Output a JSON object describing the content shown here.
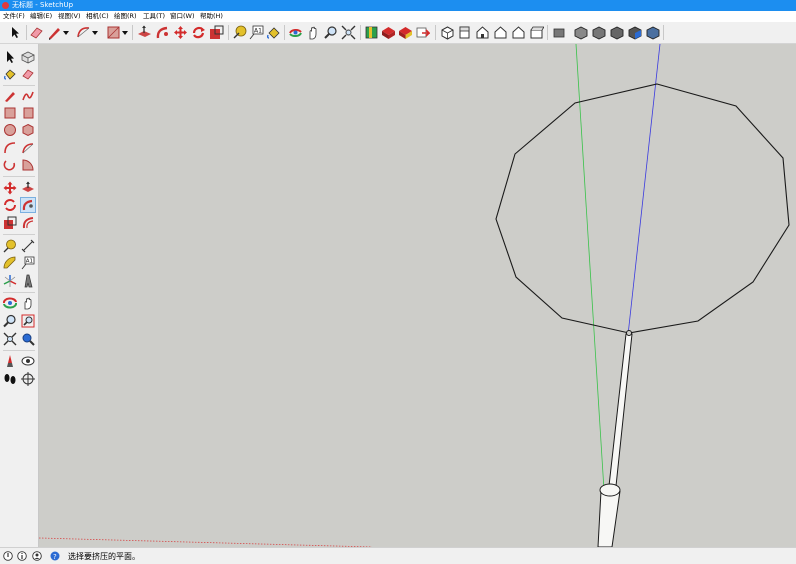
{
  "window": {
    "title": "无标题 - SketchUp"
  },
  "menu": [
    "文件(F)",
    "编辑(E)",
    "视图(V)",
    "相机(C)",
    "绘图(R)",
    "工具(T)",
    "窗口(W)",
    "帮助(H)"
  ],
  "toolbar_icons": [
    "select-icon",
    "eraser-icon",
    "pencil-line-icon",
    "dropdown-arrow-icon",
    "arc-icon",
    "dropdown-arrow-icon",
    "rectangle-icon",
    "dropdown-arrow-icon",
    "push-pull-icon",
    "follow-me-icon",
    "move-icon",
    "rotate-icon",
    "scale-icon",
    "tape-measure-icon",
    "text-icon",
    "paint-bucket-icon",
    "orbit-icon",
    "pan-icon",
    "zoom-icon",
    "zoom-extents-icon",
    "book-icon",
    "components-icon",
    "materials-icon",
    "3d-warehouse-icon",
    "iso-view-icon",
    "top-view-icon",
    "front-view-icon",
    "right-view-icon",
    "back-view-icon",
    "left-view-icon",
    "xray-icon",
    "wireframe-icon",
    "hidden-line-icon",
    "shaded-icon",
    "textured-icon",
    "monochrome-icon"
  ],
  "sidebar_icons": [
    "select-icon",
    "component-icon",
    "paint-bucket-icon",
    "eraser-icon",
    "line-icon",
    "freehand-icon",
    "rectangle-icon",
    "rotated-rectangle-icon",
    "circle-icon",
    "polygon-icon",
    "arc-icon",
    "two-point-arc-icon",
    "three-point-arc-icon",
    "pie-icon",
    "move-icon",
    "push-pull-icon",
    "rotate-icon",
    "follow-me-icon",
    "scale-icon",
    "offset-icon",
    "tape-measure-icon",
    "dimension-icon",
    "protractor-icon",
    "text-icon",
    "axes-icon",
    "3d-text-icon",
    "orbit-icon",
    "pan-icon",
    "zoom-icon",
    "zoom-window-icon",
    "zoom-extents-icon",
    "previous-view-icon",
    "position-camera-icon",
    "look-around-icon",
    "walk-icon",
    "section-plane-icon"
  ],
  "colors": {
    "viewport": "#cdcdc9",
    "green_axis": "#39c24a",
    "blue_axis": "#3a3adf",
    "red_axis": "#d64a4a",
    "edge": "#1a1a1a"
  },
  "status": {
    "text": "选择要挤压的平面。"
  }
}
